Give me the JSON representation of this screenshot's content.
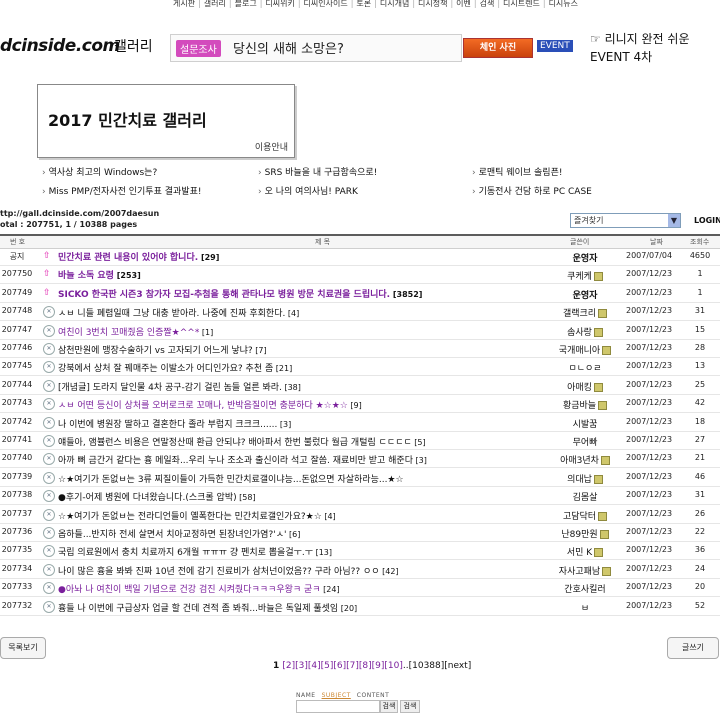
{
  "topnav": [
    "게시판",
    "갤러리",
    "블로그",
    "디씨위키",
    "디씨인사이드",
    "토론",
    "디시개념",
    "디시정책",
    "이벤",
    "검색",
    "디시트렌드",
    "디시뉴스"
  ],
  "header": {
    "logo": "dcinside.com",
    "logo_sub": "갤러리",
    "survey_badge": "설문조사",
    "survey_text": "당신의 새해 소망은?",
    "event_pic": "체인 사진",
    "event_badge": "EVENT",
    "event_text_1": "☞ 리니지 완전 쉬운",
    "event_text_2": "EVENT 4차"
  },
  "gallery": {
    "title": "2017 민간치료 갤러리",
    "guide": "이용안내"
  },
  "news": [
    [
      "역사상 최고의 Windows는?",
      "SRS 바늘을 내  구급함속으로!",
      "로맨틱 웨이브 솔림픈!"
    ],
    [
      "Miss PMP/전자사전 인기투표 결과발표!",
      "오 나의 여의사님! PARK",
      "기동전사 건담 하로 PC CASE"
    ]
  ],
  "meta": {
    "url": "ttp://gall.dcinside.com/2007daesun",
    "total": "otal : 207751, 1 / 10388 pages",
    "favorites": "즐겨찾기",
    "login": "LOGIN"
  },
  "table": {
    "headers": {
      "no": "번 호",
      "title": "제 목",
      "writer": "글쓴이",
      "date": "날짜",
      "views": "조회수"
    },
    "rows": [
      {
        "no": "공지",
        "title": "민간치료 관련 내용이 있어야 합니다.",
        "cmt": "[29]",
        "writer": "운영자",
        "date": "2007/07/04",
        "views": "4650",
        "style": "notice",
        "writer_style": "bold"
      },
      {
        "no": "207750",
        "title": "바늘 소독 요령",
        "cmt": "[253]",
        "writer": "쿠케케",
        "date": "2007/12/23",
        "views": "1",
        "style": "notice",
        "writer_style": "gicon"
      },
      {
        "no": "207749",
        "title": "SICKO 한국판 시즌3 참가자 모집-추첨을 통해 관타나모 병원 방문 치료권을 드립니다.",
        "cmt": "[3852]",
        "writer": "운영자",
        "date": "2007/12/23",
        "views": "1",
        "style": "notice",
        "writer_style": "bold"
      },
      {
        "no": "207748",
        "title": "ㅅㅂ 니들 폐렴일때 그냥 대충 받아라. 나중에 진짜 후회한다.",
        "cmt": "[4]",
        "writer": "갤랙크리",
        "date": "2007/12/23",
        "views": "31",
        "style": "normal",
        "writer_style": "gicon"
      },
      {
        "no": "207747",
        "title": "여친이 3번치 꼬매줬음 인증짤★^^*",
        "cmt": "[1]",
        "writer": "솜사랑",
        "date": "2007/12/23",
        "views": "15",
        "style": "purple",
        "writer_style": "gicon"
      },
      {
        "no": "207746",
        "title": "삼천만원에 맹장수술하기 vs 고자되기 어느게 낳냐?",
        "cmt": "[7]",
        "writer": "국개매니아",
        "date": "2007/12/23",
        "views": "28",
        "style": "normal",
        "writer_style": "gicon"
      },
      {
        "no": "207745",
        "title": "강북에서 상처 잘 꿰매주는 이발소가 어디인가요? 추천 좀",
        "cmt": "[21]",
        "writer": "ㅁㄴㅇㄹ",
        "date": "2007/12/23",
        "views": "13",
        "style": "normal",
        "writer_style": "plain"
      },
      {
        "no": "207744",
        "title": "[개념글] 도라지 달인물 4차 공구-감기 걸린 놈들 얼른 봐라.",
        "cmt": "[38]",
        "writer": "아매킹",
        "date": "2007/12/23",
        "views": "25",
        "style": "normal",
        "writer_style": "gicon"
      },
      {
        "no": "207743",
        "title": "ㅅㅂ 어떤 등신이 상처를 오버로크로 꼬매나, 반박음질이면 충분하다 ★☆★☆",
        "cmt": "[9]",
        "writer": "황금바늘",
        "date": "2007/12/23",
        "views": "42",
        "style": "purple",
        "writer_style": "gicon"
      },
      {
        "no": "207742",
        "title": "나 이번에 병원장 딸하고 결혼한다 졸라 부럽지 크크크......",
        "cmt": "[3]",
        "writer": "시발꿈",
        "date": "2007/12/23",
        "views": "18",
        "style": "normal",
        "writer_style": "plain"
      },
      {
        "no": "207741",
        "title": "얘들아, 앰뷸런스 비용은 연말정산때 환급 안되냐? 배아파서 한번 불렀다 월급 개털림 ㄷㄷㄷㄷ",
        "cmt": "[5]",
        "writer": "무어빠",
        "date": "2007/12/23",
        "views": "27",
        "style": "normal",
        "writer_style": "plain"
      },
      {
        "no": "207740",
        "title": "아까 뼈 금간거 같다는 흉 메일좌...우리 누나 조소과 출신이라 석고 잘씀. 재료비만 받고 해준다",
        "cmt": "[3]",
        "writer": "아매3년차",
        "date": "2007/12/23",
        "views": "21",
        "style": "normal",
        "writer_style": "gicon"
      },
      {
        "no": "207739",
        "title": "☆★여기가 돈없ㅂ는 3류 찌질이들이 가득한 민간치료갤이냐능...돈없으면 자살하라능...★☆",
        "cmt": "",
        "writer": "의대납",
        "date": "2007/12/23",
        "views": "46",
        "style": "normal",
        "writer_style": "gicon"
      },
      {
        "no": "207738",
        "title": "●후기-어제 병원에 다녀왔습니다.(스크롤 압박)",
        "cmt": "[58]",
        "writer": "김몸살",
        "date": "2007/12/23",
        "views": "31",
        "style": "normal",
        "writer_style": "plain"
      },
      {
        "no": "207737",
        "title": "☆★여기가 돈없ㅂ는 전라디언들이 옐폭한다는 민간치료갤인가요?★☆",
        "cmt": "[4]",
        "writer": "고담닥터",
        "date": "2007/12/23",
        "views": "26",
        "style": "normal",
        "writer_style": "gicon"
      },
      {
        "no": "207736",
        "title": "옵하들...반지하 전세 살면서 치아교정하면 된장녀인가염?'ㅅ'",
        "cmt": "[6]",
        "writer": "난89만원",
        "date": "2007/12/23",
        "views": "22",
        "style": "normal",
        "writer_style": "gicon"
      },
      {
        "no": "207735",
        "title": "국립 의료원에서 충치 치료까지 6개월 ㅠㅠㅠ 걍 펜치로 뽑을걸ㅜ.ㅜ",
        "cmt": "[13]",
        "writer": "서민 K",
        "date": "2007/12/23",
        "views": "36",
        "style": "normal",
        "writer_style": "gicon"
      },
      {
        "no": "207734",
        "title": "나이 많은 흉을 봐봐 진짜 10년 전에 감기 진료비가 삼처넌이었음?? 구라 아님?? ㅇㅇ",
        "cmt": "[42]",
        "writer": "자사고패남",
        "date": "2007/12/23",
        "views": "24",
        "style": "normal",
        "writer_style": "gicon"
      },
      {
        "no": "207733",
        "title": "●아놔 나 여친이 백일 기념으로 건강 검진 시켜줬다ㅋㅋㅋ우왕ㅋ 굳ㅋ",
        "cmt": "[24]",
        "writer": "간호사킬러",
        "date": "2007/12/23",
        "views": "20",
        "style": "purple",
        "writer_style": "plain"
      },
      {
        "no": "207732",
        "title": "흉들 나 이번에 구급상자 업글 할 건데 견적 좀 봐줘...바늘은 독일제 풀셋임",
        "cmt": "[20]",
        "writer": "ㅂ",
        "date": "2007/12/23",
        "views": "52",
        "style": "normal",
        "writer_style": "plain"
      }
    ]
  },
  "footer": {
    "prev_btn": "목록보기",
    "write_btn": "글쓰기",
    "pager_current": "1",
    "pager_pages": [
      "[2]",
      "[3]",
      "[4]",
      "[5]",
      "[6]",
      "[7]",
      "[8]",
      "[9]",
      "[10]"
    ],
    "pager_tail": "..[10388][next]",
    "search_tabs": [
      "NAME",
      "SUBJECT",
      "CONTENT"
    ],
    "search_btn": "검색",
    "search_btn2": "검색"
  },
  "colors": {
    "notice": "#7a1f9c",
    "purple_title": "#7a1f9c",
    "badge_pink": "#d34bbd",
    "event_blue": "#2a4fb8"
  }
}
